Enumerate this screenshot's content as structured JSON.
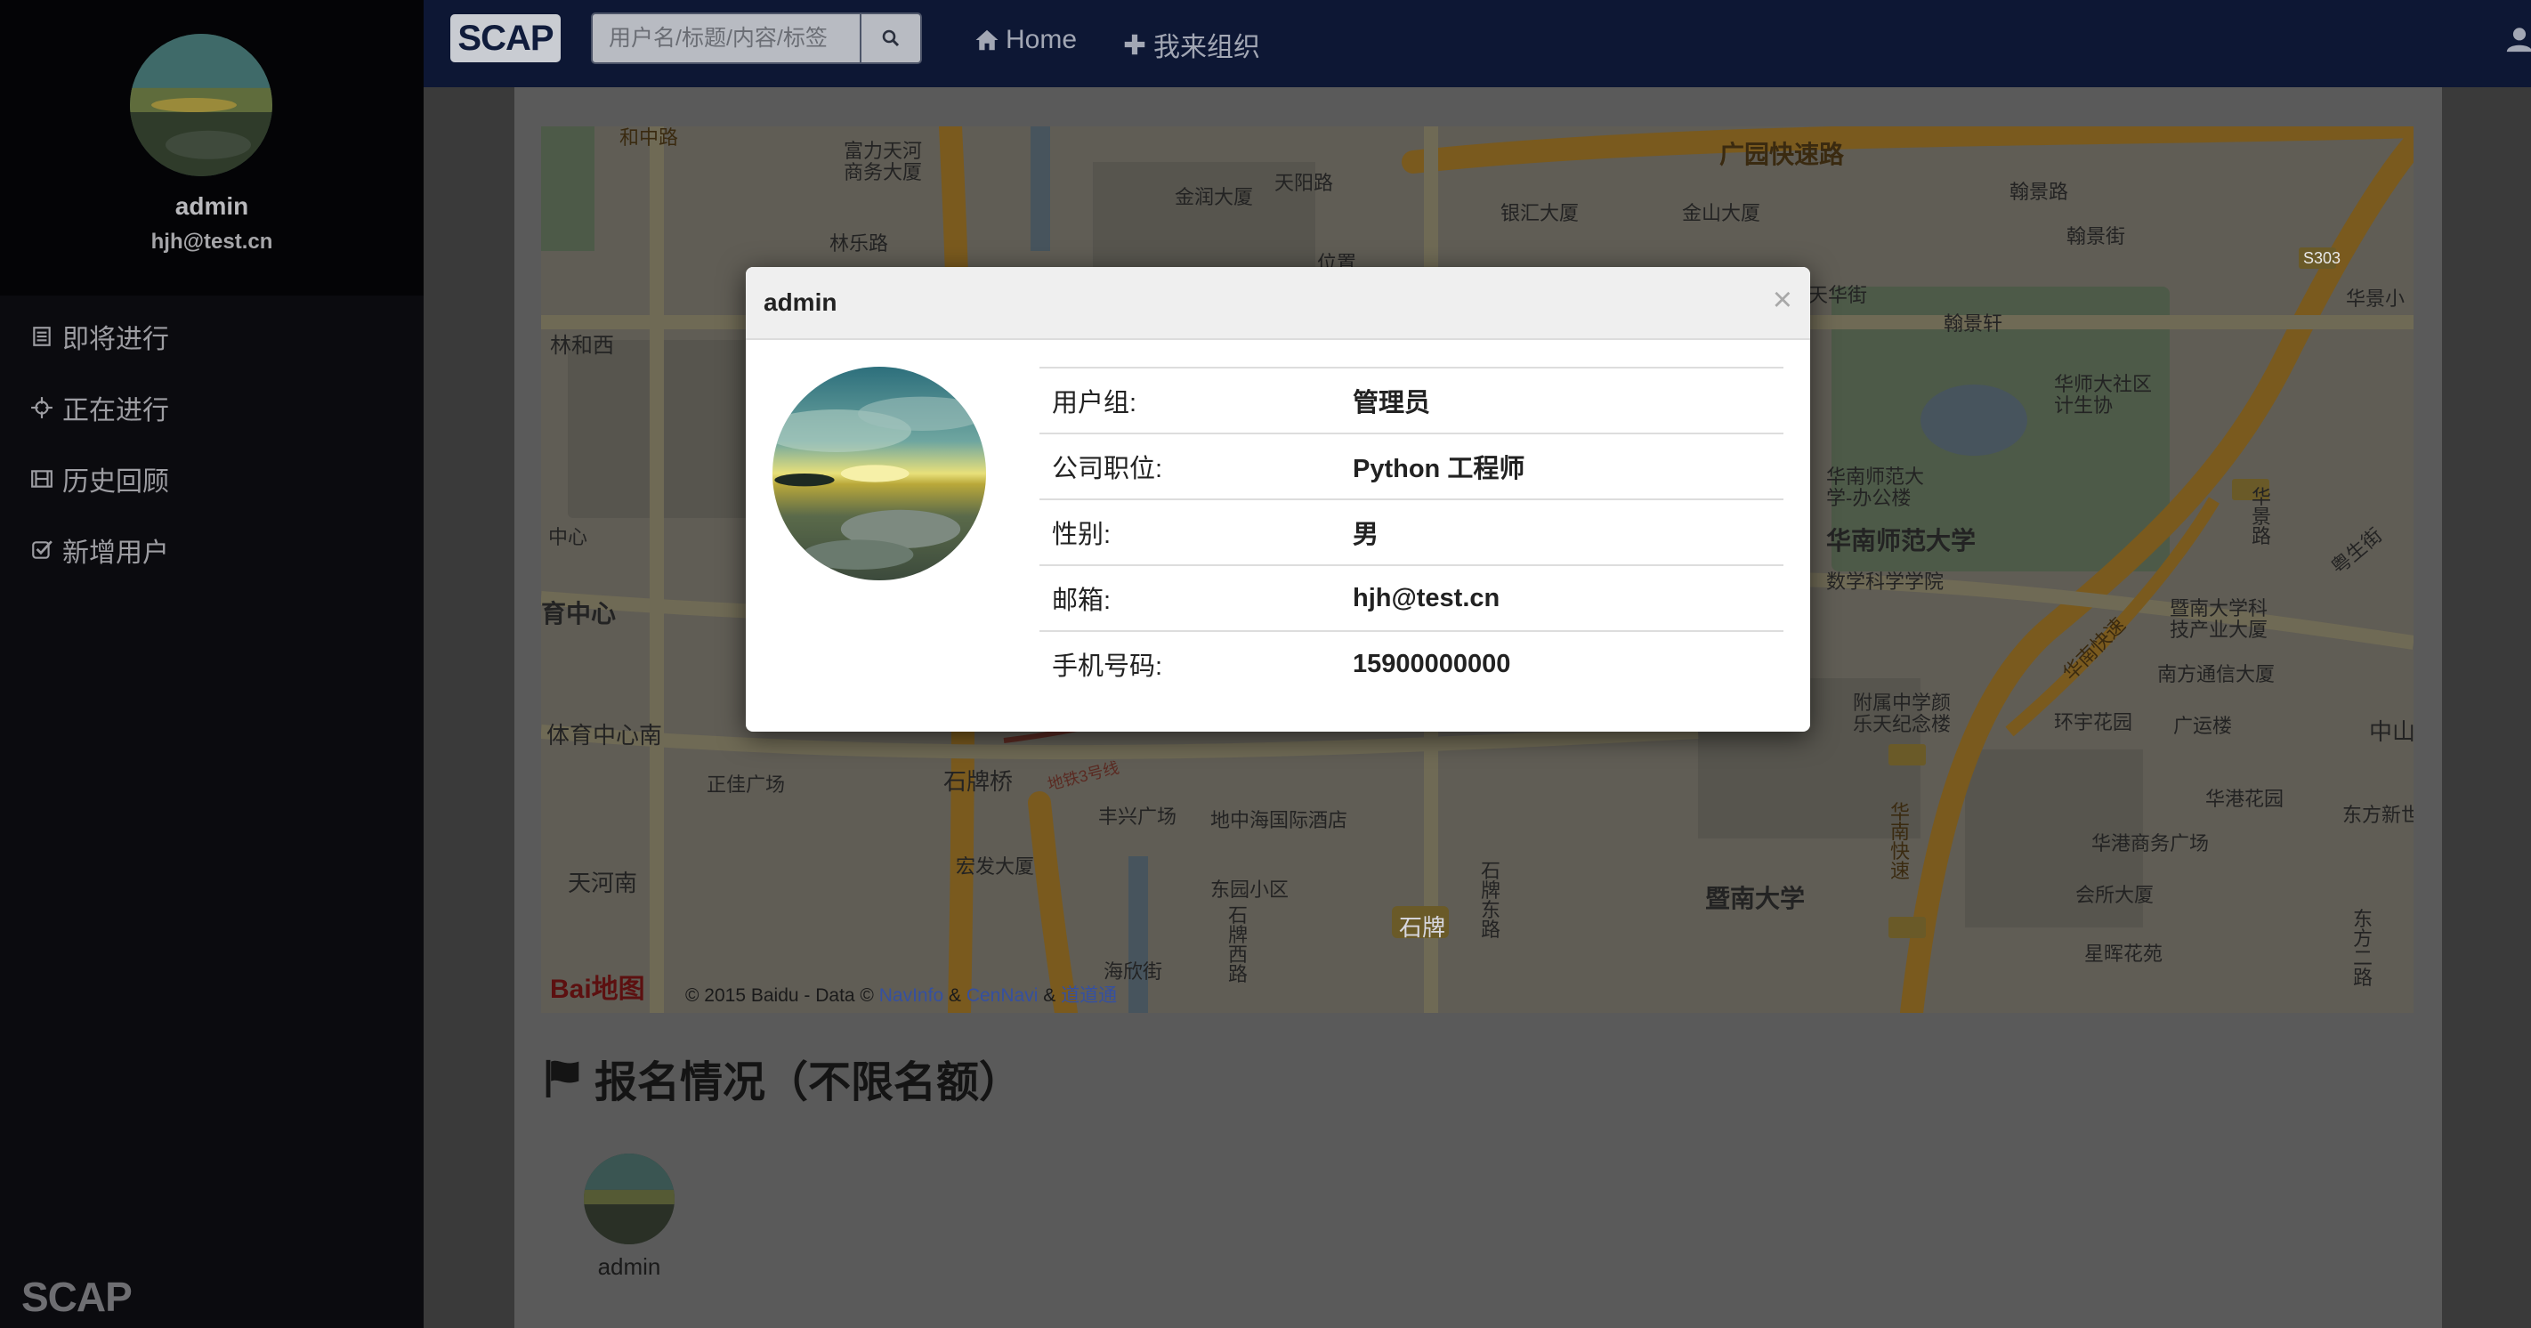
{
  "sidebar": {
    "user_name": "admin",
    "user_email": "hjh@test.cn",
    "nav": [
      {
        "label": "即将进行",
        "icon": "list-icon"
      },
      {
        "label": "正在进行",
        "icon": "crosshair-icon"
      },
      {
        "label": "历史回顾",
        "icon": "film-icon"
      },
      {
        "label": "新增用户",
        "icon": "check-square-icon"
      }
    ],
    "brand": "SCAP"
  },
  "topbar": {
    "brand": "SCAP",
    "search_placeholder": "用户名/标题/内容/标签",
    "links": [
      {
        "label": "Home",
        "icon": "home-icon"
      },
      {
        "label": "我来组织",
        "icon": "plus-icon"
      }
    ]
  },
  "map": {
    "labels": [
      "和中路",
      "富力天河商务大厦",
      "天阳路",
      "金润大厦",
      "银汇大厦",
      "金山大厦",
      "广园快速路",
      "翰景路",
      "翰景街",
      "林乐路",
      "位置",
      "天华街",
      "翰景轩",
      "S303",
      "华景小",
      "林和西",
      "华师大社区计生协",
      "华南师范大学-办公楼",
      "华南师范大学",
      "数学科学学院",
      "中心",
      "育中心",
      "暨南大学科技产业大厦",
      "南方通信大厦",
      "附属中学颜乐天纪念楼",
      "环宇花园",
      "广运楼",
      "体育中心南",
      "正佳广场",
      "石牌桥",
      "丰兴广场",
      "地中海国际酒店",
      "华港花园",
      "华港商务广场",
      "东方新世",
      "天河南",
      "宏发大厦",
      "东园小区",
      "石牌",
      "暨南大学",
      "会所大厦",
      "星晖花苑",
      "海欣街",
      "石牌西路",
      "石牌东路",
      "华南快速",
      "中山",
      "地铁3号线",
      "东方二路",
      "粤生街",
      "华景路",
      "华南快速"
    ],
    "copyright_prefix": "© 2015 Baidu - Data ©",
    "copyright_links": [
      "NavInfo",
      "&",
      "CenNavi",
      "&",
      "道道通"
    ],
    "logo": "Bai地图"
  },
  "section": {
    "title": "报名情况（不限名额）",
    "attendee_name": "admin"
  },
  "modal": {
    "title": "admin",
    "close": "×",
    "rows": [
      {
        "label": "用户组:",
        "value": "管理员"
      },
      {
        "label": "公司职位:",
        "value": "Python 工程师"
      },
      {
        "label": "性别:",
        "value": "男"
      },
      {
        "label": "邮箱:",
        "value": "hjh@test.cn"
      },
      {
        "label": "手机号码:",
        "value": "15900000000"
      }
    ]
  },
  "colors": {
    "sidebar_bg": "#0b0b0f",
    "topbar_bg": "#0d1734",
    "overlay": "#3a3a3a",
    "map_road": "#8a5a10"
  }
}
